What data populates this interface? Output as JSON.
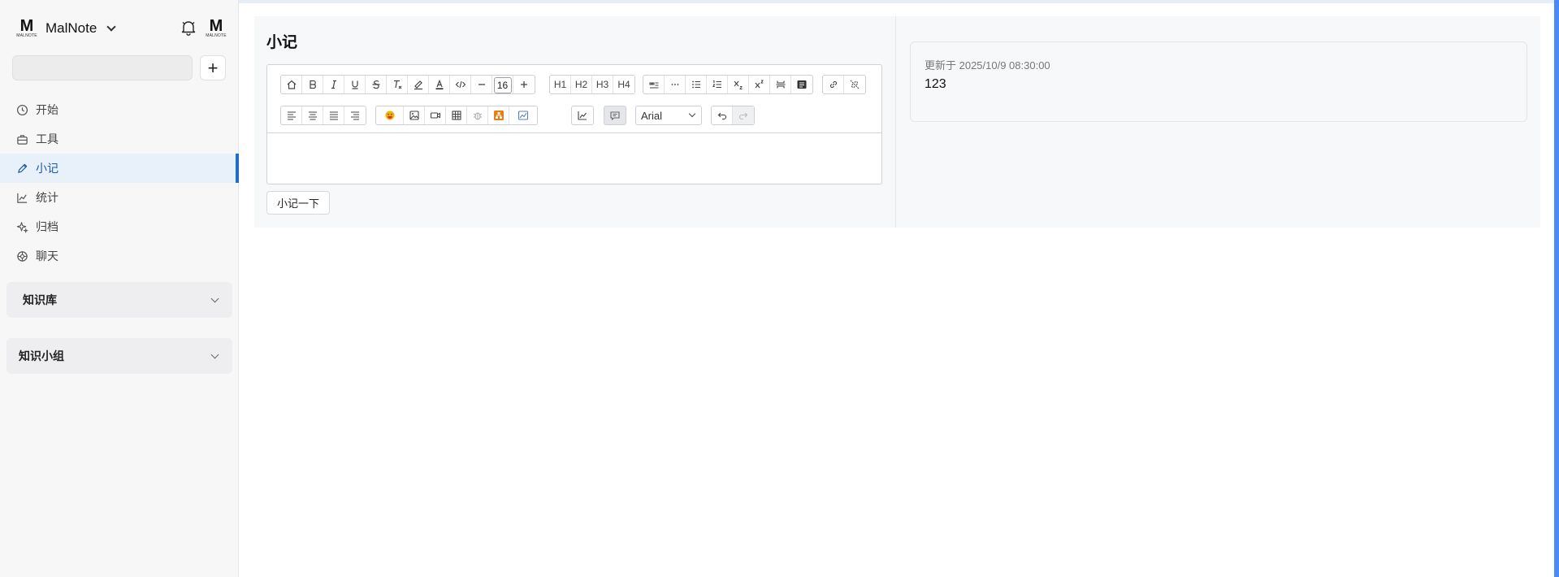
{
  "app": {
    "name": "MalNote",
    "logo_letter": "M",
    "logo_wordmark": "MALNOTE"
  },
  "sidebar": {
    "search_placeholder": "",
    "add_label": "+",
    "items": [
      {
        "label": "开始",
        "icon": "clock-icon",
        "active": false
      },
      {
        "label": "工具",
        "icon": "toolbox-icon",
        "active": false
      },
      {
        "label": "小记",
        "icon": "pen-icon",
        "active": true
      },
      {
        "label": "统计",
        "icon": "line-chart-icon",
        "active": false
      },
      {
        "label": "归档",
        "icon": "sparkle-icon",
        "active": false
      },
      {
        "label": "聊天",
        "icon": "chat-icon",
        "active": false
      }
    ],
    "sections": [
      {
        "label": "知识库"
      },
      {
        "label": "知识小组"
      }
    ]
  },
  "main": {
    "title": "小记",
    "toolbar": {
      "font_size": "16",
      "font_family": "Arial",
      "heading_labels": [
        "H1",
        "H2",
        "H3",
        "H4"
      ]
    },
    "editor_content": "",
    "submit_label": "小记一下"
  },
  "notes": [
    {
      "updated": "更新于 2025/10/9 08:30:00",
      "content": "123"
    }
  ],
  "colors": {
    "accent": "#1f6fc5",
    "active_bg": "#e8f1fa",
    "right_edge": "#4a8af4"
  }
}
